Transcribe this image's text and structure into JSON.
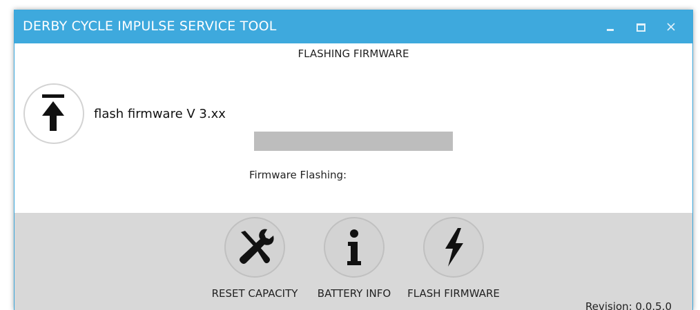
{
  "window": {
    "title": "DERBY CYCLE IMPULSE SERVICE TOOL"
  },
  "main": {
    "heading": "FLASHING FIRMWARE",
    "version_text": "flash firmware V 3.xx",
    "progress": 1.0,
    "status_text": "Firmware Flashing:"
  },
  "nav": {
    "buttons": [
      {
        "label": "RESET CAPACITY",
        "icon": "wrench-screwdriver-icon"
      },
      {
        "label": "BATTERY INFO",
        "icon": "info-icon"
      },
      {
        "label": "FLASH FIRMWARE",
        "icon": "lightning-icon"
      }
    ]
  },
  "footer": {
    "revision": "Revision: 0.0.5.0"
  },
  "colors": {
    "titlebar": "#3ea9dd",
    "bottom_panel": "#d8d8d8",
    "progress_fill": "#bdbdbd"
  }
}
